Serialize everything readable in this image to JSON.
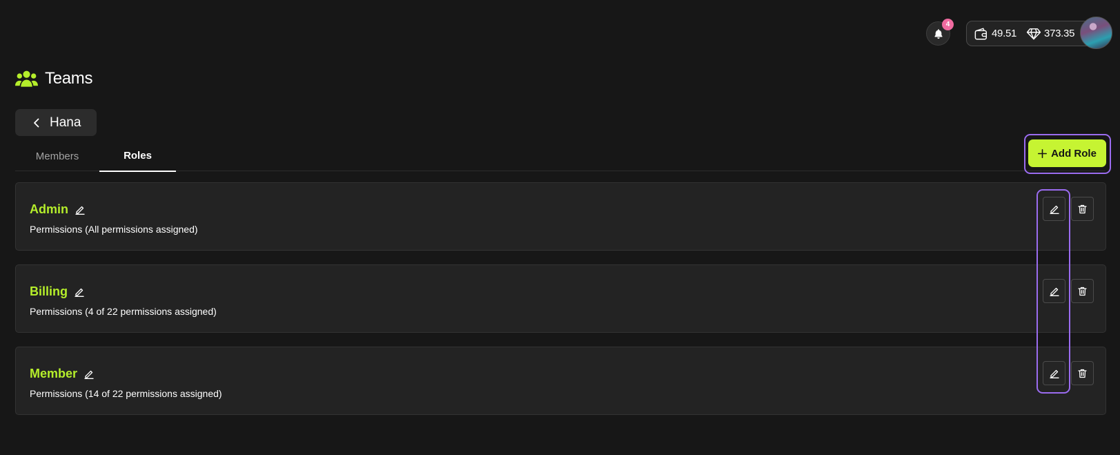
{
  "topbar": {
    "notifications_count": "4",
    "wallet_balance": "49.51",
    "gem_balance": "373.35"
  },
  "header": {
    "title": "Teams"
  },
  "back_button": {
    "label": "Hana"
  },
  "tabs": [
    {
      "label": "Members",
      "active": false
    },
    {
      "label": "Roles",
      "active": true
    }
  ],
  "add_role_button": {
    "label": "Add Role"
  },
  "roles": [
    {
      "name": "Admin",
      "permissions": "Permissions (All permissions assigned)"
    },
    {
      "name": "Billing",
      "permissions": "Permissions (4 of 22 permissions assigned)"
    },
    {
      "name": "Member",
      "permissions": "Permissions (14 of 22 permissions assigned)"
    }
  ],
  "colors": {
    "accent_green": "#c6f432",
    "role_name_green": "#b5ee2b",
    "highlight_purple": "#9b6cf0",
    "badge_pink": "#f06ba0",
    "background": "#171717"
  },
  "icons": {
    "notifications": "bell-icon",
    "wallet": "wallet-icon",
    "gem": "diamond-icon",
    "teams": "users-icon",
    "back": "chevron-left-icon",
    "add": "plus-icon",
    "edit": "pencil-icon",
    "delete": "trash-icon"
  }
}
